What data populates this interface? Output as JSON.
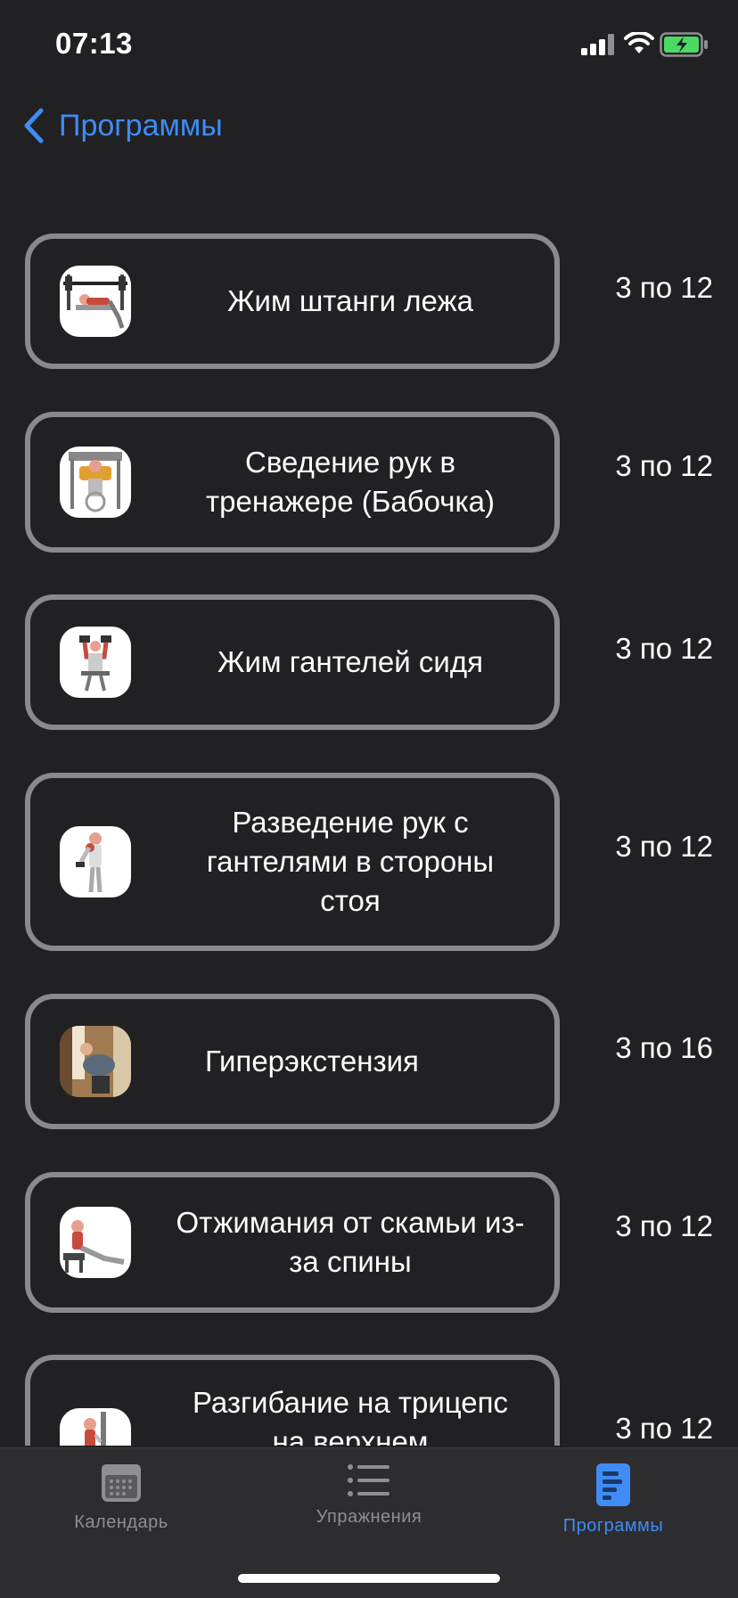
{
  "status": {
    "time": "07:13"
  },
  "nav": {
    "back_label": "Программы"
  },
  "exercises": [
    {
      "title": "Жим штанги лежа",
      "sets": "3 по 12",
      "thumb": "bench-press-icon"
    },
    {
      "title": "Сведение рук в тренажере (Бабочка)",
      "sets": "3 по 12",
      "thumb": "butterfly-machine-icon"
    },
    {
      "title": "Жим гантелей сидя",
      "sets": "3 по 12",
      "thumb": "seated-dumbbell-press-icon"
    },
    {
      "title": "Разведение рук с гантелями в стороны стоя",
      "sets": "3 по 12",
      "thumb": "lateral-raise-icon"
    },
    {
      "title": "Гиперэкстензия",
      "sets": "3 по 16",
      "thumb": "hyperextension-photo"
    },
    {
      "title": "Отжимания от скамьи из-за спины",
      "sets": "3 по 12",
      "thumb": "bench-dips-icon"
    },
    {
      "title": "Разгибание на трицепс на верхнем",
      "sets": "3 по 12",
      "thumb": "triceps-pushdown-icon"
    }
  ],
  "tabs": [
    {
      "label": "Календарь",
      "icon": "calendar-icon",
      "active": false
    },
    {
      "label": "Упражнения",
      "icon": "list-icon",
      "active": false
    },
    {
      "label": "Программы",
      "icon": "document-icon",
      "active": true
    }
  ],
  "colors": {
    "accent": "#3f8cf5",
    "background": "#212123",
    "card_border": "#8a8a8d",
    "battery": "#4cd964"
  }
}
